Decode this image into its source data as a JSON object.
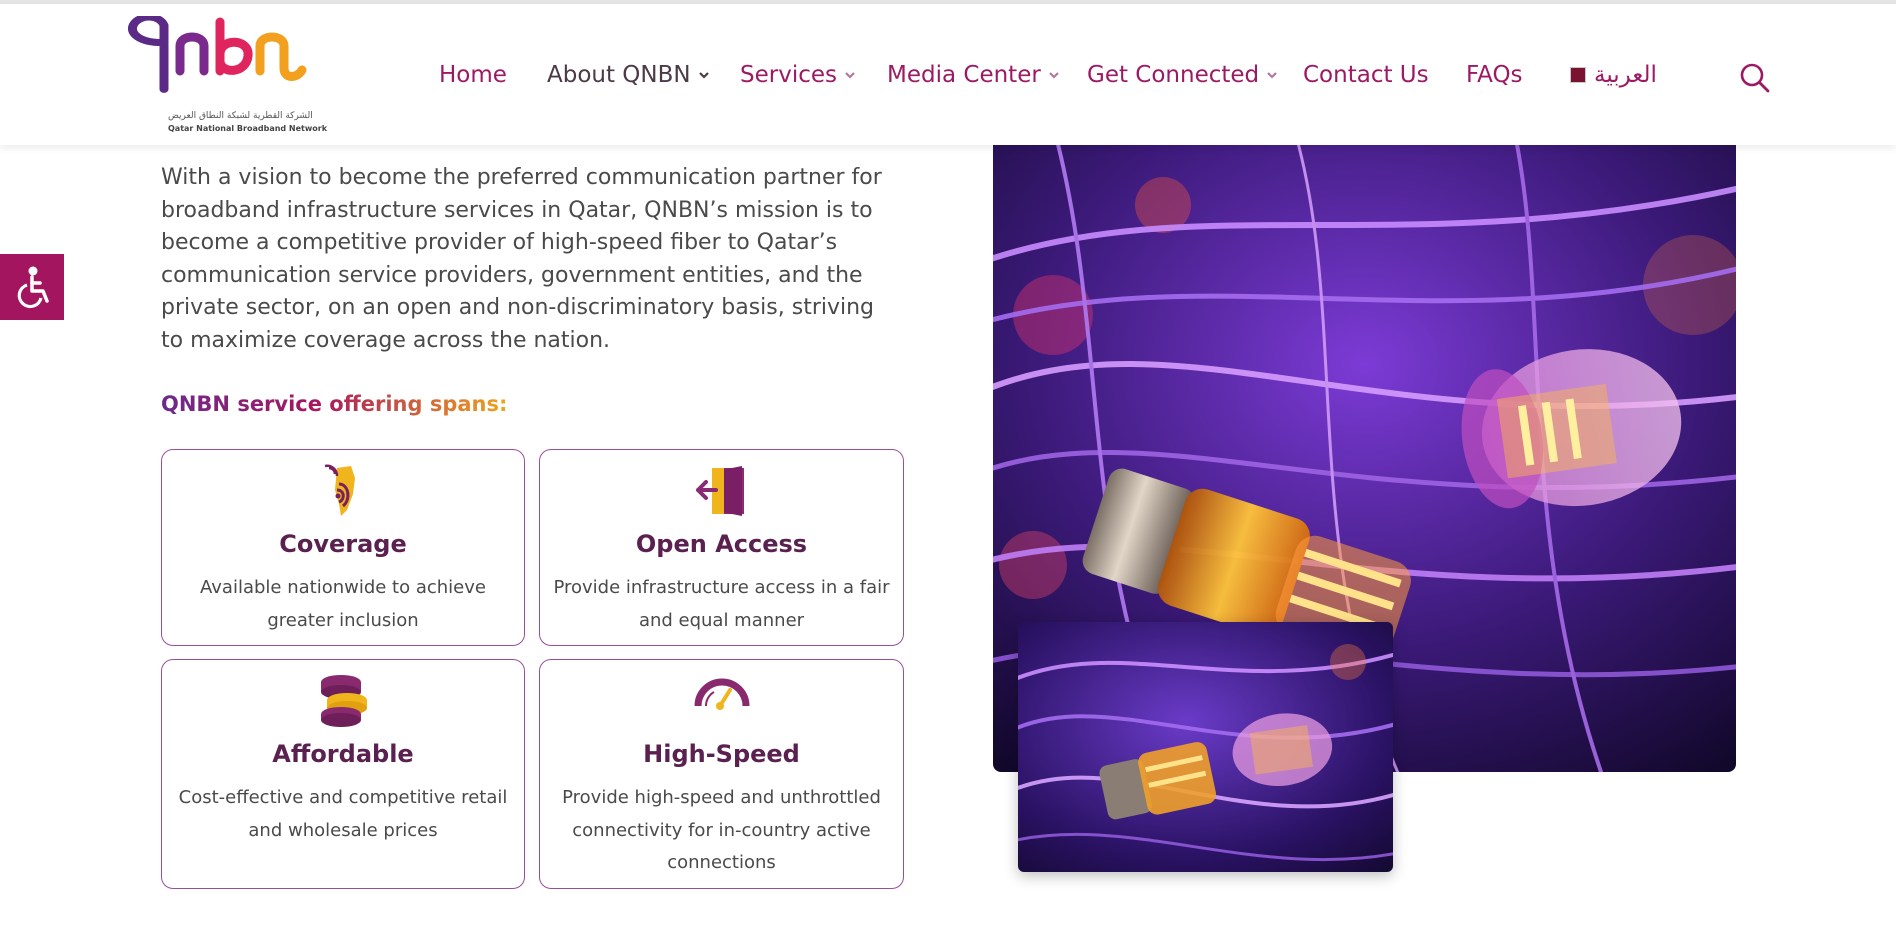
{
  "logo": {
    "wordmark": "qnbn",
    "arabic_name": "الشركة القطرية لشبكة النطاق العريض",
    "english_name": "Qatar National Broadband Network"
  },
  "nav": {
    "items": [
      {
        "label": "Home",
        "has_dropdown": false
      },
      {
        "label": "About QNBN",
        "has_dropdown": true
      },
      {
        "label": "Services",
        "has_dropdown": true
      },
      {
        "label": "Media Center",
        "has_dropdown": true
      },
      {
        "label": "Get Connected",
        "has_dropdown": true
      },
      {
        "label": "Contact Us",
        "has_dropdown": false
      },
      {
        "label": "FAQs",
        "has_dropdown": false
      }
    ],
    "language_label": "العربية",
    "search_icon": "search-icon"
  },
  "accessibility": {
    "icon": "wheelchair-icon"
  },
  "intro": {
    "text": "With a vision to become the preferred communication partner for broadband infrastructure services in Qatar, QNBN’s mission is to become a competitive provider of high-speed fiber to Qatar’s communication service providers, government entities, and the private sector, on an open and non-discriminatory basis, striving to maximize coverage across the nation."
  },
  "offering": {
    "heading": "QNBN service offering spans:",
    "cards": [
      {
        "title": "Coverage",
        "text": "Available nationwide to achieve greater inclusion",
        "icon": "coverage-map-icon"
      },
      {
        "title": "Open Access",
        "text": "Provide infrastructure access in a fair and equal manner",
        "icon": "open-door-icon"
      },
      {
        "title": "Affordable",
        "text": "Cost-effective and competitive retail and wholesale prices",
        "icon": "coins-icon"
      },
      {
        "title": "High-Speed",
        "text": "Provide high-speed and unthrottled connectivity for in-country active connections",
        "icon": "speedometer-icon"
      }
    ]
  },
  "colors": {
    "brand_magenta": "#a3165f",
    "brand_purple": "#5a2150",
    "brand_yellow": "#f0b41c"
  }
}
